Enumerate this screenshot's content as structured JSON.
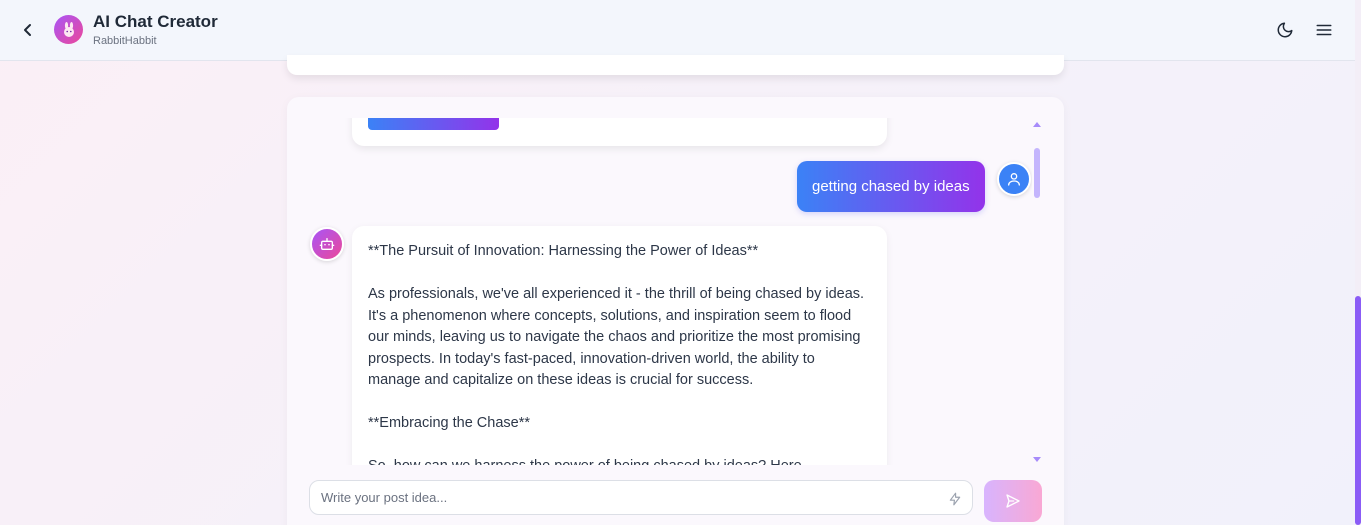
{
  "header": {
    "title": "AI Chat Creator",
    "subtitle": "RabbitHabbit",
    "icons": [
      "back-arrow-icon",
      "rabbit-logo-icon",
      "moon-icon",
      "menu-icon"
    ]
  },
  "chat": {
    "user_message": "getting chased by ideas",
    "bot_message": {
      "heading": "**The Pursuit of Innovation: Harnessing the Power of Ideas**",
      "paragraph1": "As professionals, we've all experienced it - the thrill of being chased by ideas. It's a phenomenon where concepts, solutions, and inspiration seem to flood our minds, leaving us to navigate the chaos and prioritize the most promising prospects. In today's fast-paced, innovation-driven world, the ability to manage and capitalize on these ideas is crucial for success.",
      "subheading": "**Embracing the Chase**",
      "paragraph2": "So, how can we harness the power of being chased by ideas? Here"
    }
  },
  "composer": {
    "placeholder": "Write your post idea...",
    "value": ""
  },
  "colors": {
    "accent_gradient_start": "#3b82f6",
    "accent_gradient_end": "#9333ea",
    "bot_avatar_start": "#a855f7",
    "bot_avatar_end": "#ec4899",
    "user_avatar": "#3b82f6"
  }
}
